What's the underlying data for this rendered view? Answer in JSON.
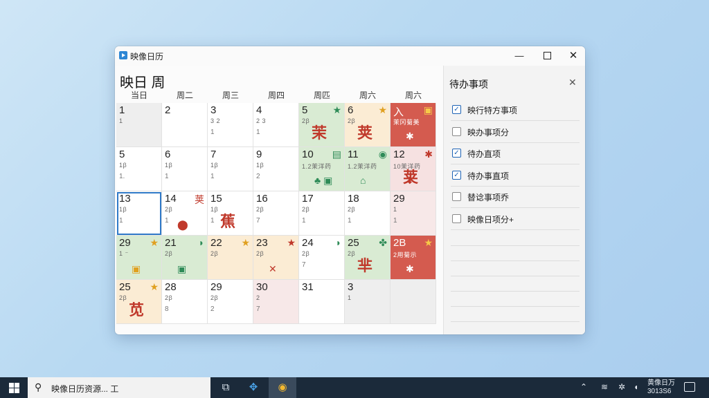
{
  "window": {
    "title": "映像日历",
    "minimize_glyph": "—",
    "close_glyph": "✕"
  },
  "calendar": {
    "view_title": "映日 周",
    "weekdays": [
      "当日",
      "周二",
      "周三",
      "周四",
      "周匹",
      "周六",
      "周六"
    ],
    "weeks": [
      [
        {
          "day": "1",
          "l1": "1",
          "l2": "",
          "bg": "grey"
        },
        {
          "day": "2",
          "l1": "",
          "l2": "",
          "bg": "w"
        },
        {
          "day": "3",
          "l1": "3 2",
          "l2": "1",
          "bg": "w"
        },
        {
          "day": "4",
          "l1": "2 3",
          "l2": "1",
          "bg": "w"
        },
        {
          "day": "5",
          "l1": "2β",
          "l2": "",
          "bg": "green",
          "badge": "★",
          "badge_color": "#2e8b57",
          "big": "茉"
        },
        {
          "day": "6",
          "l1": "2β",
          "l2": "",
          "bg": "peach",
          "badge": "★",
          "badge_color": "#e0a020",
          "big": "荚"
        },
        {
          "day": "入",
          "l1": "茉冈菊美",
          "l2": "",
          "bg": "red",
          "badge": "▣",
          "badge_color": "#f7c948",
          "icon": "✱"
        }
      ],
      [
        {
          "day": "5",
          "l1": "1β",
          "l2": "1.",
          "bg": "w"
        },
        {
          "day": "6",
          "l1": "1β",
          "l2": "1",
          "bg": "w"
        },
        {
          "day": "7",
          "l1": "1β",
          "l2": "1",
          "bg": "w"
        },
        {
          "day": "9",
          "l1": "1β",
          "l2": "2",
          "bg": "w"
        },
        {
          "day": "10",
          "l1": "1.2茉洋药",
          "l2": "",
          "bg": "green",
          "badge": "▤",
          "badge_color": "#2e8b57",
          "icon": "♣ ▣"
        },
        {
          "day": "11",
          "l1": "1.2茉洋药",
          "l2": "",
          "bg": "green",
          "badge": "◉",
          "badge_color": "#2e8b57",
          "icon": "⌂"
        },
        {
          "day": "12",
          "l1": "10茉洋药",
          "l2": "",
          "bg": "pink",
          "badge": "✱",
          "badge_color": "#c0392b",
          "big": "荚",
          "icon": "⬇"
        }
      ],
      [
        {
          "day": "13",
          "l1": "1β",
          "l2": "1",
          "bg": "w",
          "selected": true
        },
        {
          "day": "14",
          "l1": "2β",
          "l2": "1",
          "bg": "w",
          "badge": "荚",
          "badge_color": "#c0392b",
          "icon": "⬤"
        },
        {
          "day": "15",
          "l1": "1β",
          "l2": "1",
          "bg": "w",
          "big": "蕉"
        },
        {
          "day": "16",
          "l1": "2β",
          "l2": "7",
          "bg": "w"
        },
        {
          "day": "17",
          "l1": "2β",
          "l2": "1",
          "bg": "w"
        },
        {
          "day": "18",
          "l1": "2β",
          "l2": "1",
          "bg": "w"
        },
        {
          "day": "29",
          "l1": "1",
          "l2": "1",
          "bg": "ltpink"
        }
      ],
      [
        {
          "day": "29",
          "l1": "1 ⁻",
          "l2": "",
          "bg": "green",
          "badge": "★",
          "badge_color": "#e0a020",
          "icon": "▣"
        },
        {
          "day": "21",
          "l1": "2β",
          "l2": "",
          "bg": "green",
          "badge": "◗",
          "badge_color": "#2e8b57",
          "icon": "▣"
        },
        {
          "day": "22",
          "l1": "2β",
          "l2": "",
          "bg": "peach",
          "badge": "★",
          "badge_color": "#e0a020"
        },
        {
          "day": "23",
          "l1": "2β",
          "l2": "",
          "bg": "peach",
          "badge": "★",
          "badge_color": "#c0392b",
          "icon": "✕"
        },
        {
          "day": "24",
          "l1": "2β",
          "l2": "7",
          "bg": "w",
          "badge": "◗",
          "badge_color": "#2e8b57"
        },
        {
          "day": "25",
          "l1": "2β",
          "l2": "",
          "bg": "green",
          "badge": "✤",
          "badge_color": "#2e8b57",
          "big": "芈"
        },
        {
          "day": "2B",
          "l1": "2用菊示",
          "l2": "",
          "bg": "red",
          "badge": "★",
          "badge_color": "#f7c948",
          "icon": "✱"
        }
      ],
      [
        {
          "day": "25",
          "l1": "2β",
          "l2": "",
          "bg": "peach",
          "badge": "★",
          "badge_color": "#e0a020",
          "big": "苋"
        },
        {
          "day": "28",
          "l1": "2β",
          "l2": "8",
          "bg": "w"
        },
        {
          "day": "29",
          "l1": "2β",
          "l2": "2",
          "bg": "w"
        },
        {
          "day": "30",
          "l1": "2",
          "l2": "7",
          "bg": "ltpink"
        },
        {
          "day": "31",
          "l1": "",
          "l2": "",
          "bg": "w"
        },
        {
          "day": "3",
          "l1": "1",
          "l2": "",
          "bg": "grey"
        },
        {
          "day": "",
          "l1": "",
          "l2": "",
          "bg": "grey"
        }
      ]
    ]
  },
  "todo": {
    "title": "待办事项",
    "close_glyph": "✕",
    "items": [
      {
        "label": "映行特方事项",
        "checked": true
      },
      {
        "label": "映办事项分",
        "checked": false
      },
      {
        "label": "待办直项",
        "checked": true
      },
      {
        "label": "待办事直项",
        "checked": true
      },
      {
        "label": "替谂事项乔",
        "checked": false
      },
      {
        "label": "映像日项分+",
        "checked": false
      }
    ]
  },
  "taskbar": {
    "search_text": "映像日历资源... 工",
    "clock_line1": "黄像日万",
    "clock_line2": "3013S6"
  }
}
